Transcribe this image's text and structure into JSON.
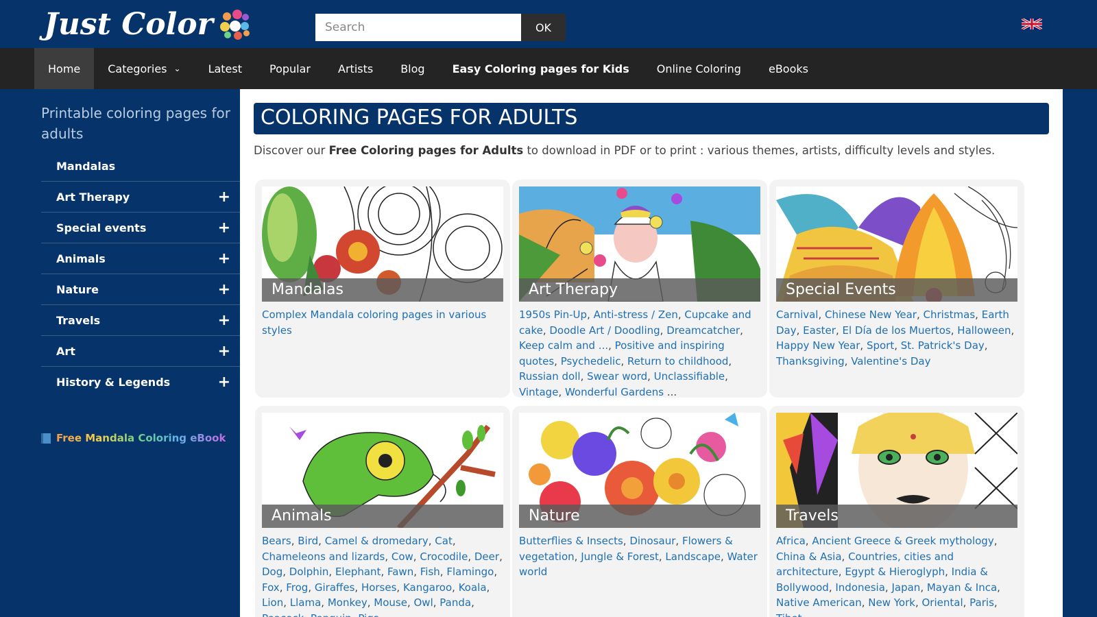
{
  "header": {
    "logo": "Just Color",
    "search": {
      "placeholder": "Search"
    },
    "ok_label": "OK",
    "language_flag": "uk-flag-icon"
  },
  "nav": {
    "items": [
      {
        "label": "Home"
      },
      {
        "label": "Categories"
      },
      {
        "label": "Latest"
      },
      {
        "label": "Popular"
      },
      {
        "label": "Artists"
      },
      {
        "label": "Blog"
      },
      {
        "label": "Easy Coloring pages for Kids"
      },
      {
        "label": "Online Coloring"
      },
      {
        "label": "eBooks"
      }
    ]
  },
  "sidebar": {
    "title": "Printable coloring pages for adults",
    "items": [
      {
        "label": "Mandalas"
      },
      {
        "label": "Art Therapy"
      },
      {
        "label": "Special events"
      },
      {
        "label": "Animals"
      },
      {
        "label": "Nature"
      },
      {
        "label": "Travels"
      },
      {
        "label": "Art"
      },
      {
        "label": "History & Legends"
      }
    ],
    "expand_symbol": "+",
    "ebook": "Free Mandala Coloring eBook"
  },
  "main": {
    "title": "COLORING PAGES FOR ADULTS",
    "intro_pre": "Discover our ",
    "intro_bold": "Free Coloring pages for Adults",
    "intro_post": " to download in PDF or to print : various themes, artists, difficulty levels and styles.",
    "cards": [
      {
        "title": "Mandalas",
        "links": [
          "Complex Mandala coloring pages in various styles"
        ],
        "more": ""
      },
      {
        "title": "Art Therapy",
        "links": [
          "1950s Pin-Up",
          "Anti-stress / Zen",
          "Cupcake and cake",
          "Doodle Art / Doodling",
          "Dreamcatcher",
          "Keep calm and ...",
          "Positive and inspiring quotes",
          "Psychedelic",
          "Return to childhood",
          "Russian doll",
          "Swear word",
          "Unclassifiable",
          "Vintage",
          "Wonderful Gardens"
        ],
        "more": " ..."
      },
      {
        "title": "Special Events",
        "links": [
          "Carnival",
          "Chinese New Year",
          "Christmas",
          "Earth Day",
          "Easter",
          "El Día de los Muertos",
          "Halloween",
          "Happy New Year",
          "Sport",
          "St. Patrick's Day",
          "Thanksgiving",
          "Valentine's Day"
        ],
        "more": ""
      },
      {
        "title": "Animals",
        "links": [
          "Bears",
          "Bird",
          "Camel & dromedary",
          "Cat",
          "Chameleons and lizards",
          "Cow",
          "Crocodile",
          "Deer",
          "Dog",
          "Dolphin",
          "Elephant",
          "Fawn",
          "Fish",
          "Flamingo",
          "Fox",
          "Frog",
          "Giraffes",
          "Horses",
          "Kangaroo",
          "Koala",
          "Lion",
          "Llama",
          "Monkey",
          "Mouse",
          "Owl",
          "Panda",
          "Peacock",
          "Penguin",
          "Pigs"
        ],
        "more": ""
      },
      {
        "title": "Nature",
        "links": [
          "Butterflies & Insects",
          "Dinosaur",
          "Flowers & vegetation",
          "Jungle & Forest",
          "Landscape",
          "Water world"
        ],
        "more": ""
      },
      {
        "title": "Travels",
        "links": [
          "Africa",
          "Ancient Greece & Greek mythology",
          "China & Asia",
          "Countries, cities and architecture",
          "Egypt & Hieroglyph",
          "India & Bollywood",
          "Indonesia",
          "Japan",
          "Mayan & Inca",
          "Native American",
          "New York",
          "Oriental",
          "Paris",
          "Tibet"
        ],
        "more": ""
      }
    ]
  },
  "colors": {
    "header_bg": "#063369",
    "navbar_bg": "#242424",
    "link": "#1f6fb2"
  }
}
